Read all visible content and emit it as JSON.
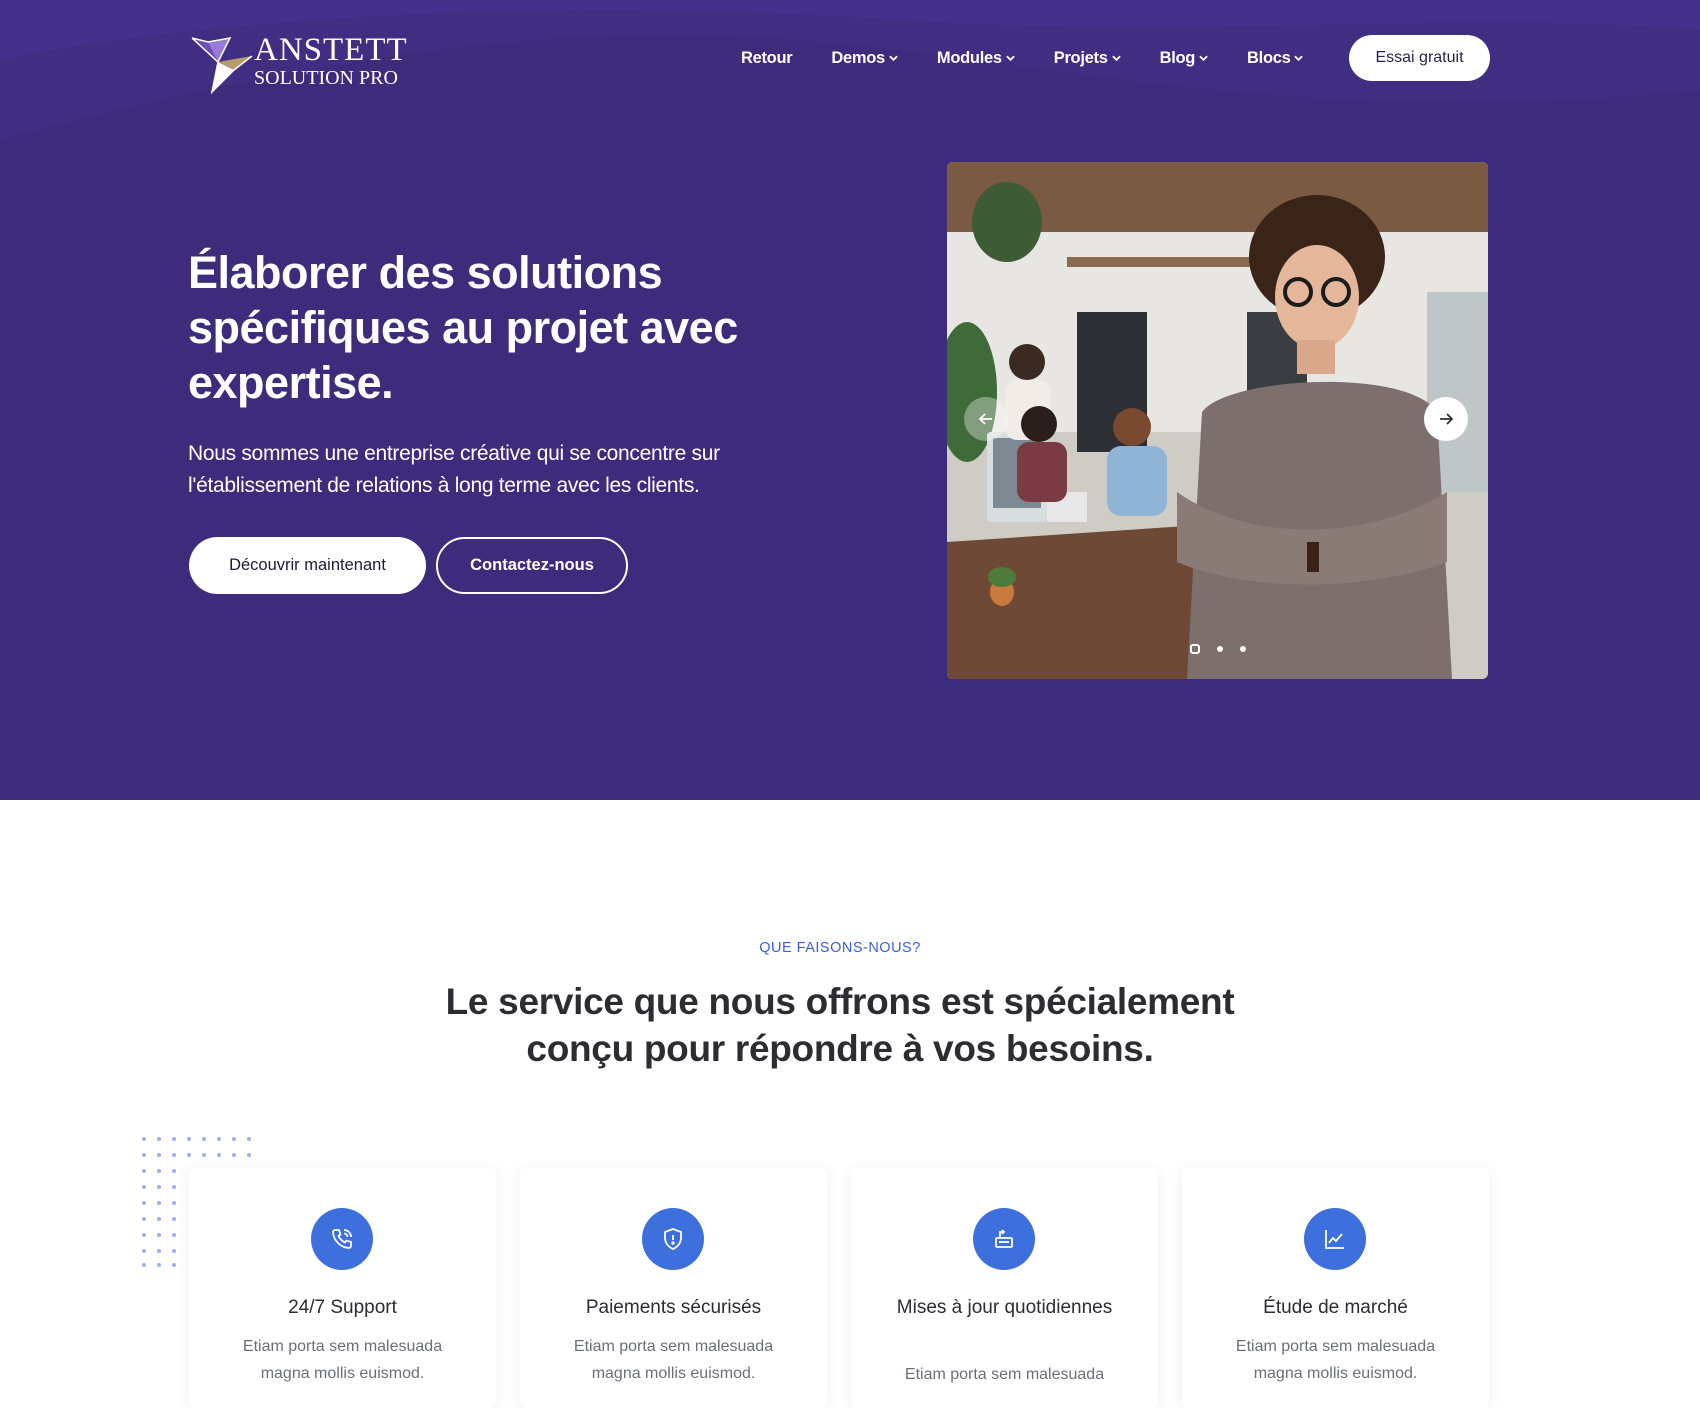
{
  "brand": {
    "name_line1": "ANSTETT",
    "name_line2": "SOLUTION PRO"
  },
  "nav": {
    "items": [
      {
        "label": "Retour"
      },
      {
        "label": "Demos"
      },
      {
        "label": "Modules"
      },
      {
        "label": "Projets"
      },
      {
        "label": "Blog"
      },
      {
        "label": "Blocs"
      }
    ],
    "cta_label": "Essai gratuit"
  },
  "hero": {
    "title": "Élaborer des solutions spécifiques au projet avec expertise.",
    "subtitle": "Nous sommes une entreprise créative qui se concentre sur l'établissement de relations à long terme avec les clients.",
    "primary_button": "Découvrir maintenant",
    "secondary_button": "Contactez-nous",
    "slider": {
      "slide_count": 3,
      "active_slide": 1
    }
  },
  "services": {
    "kicker": "QUE FAISONS-NOUS?",
    "title": "Le service que nous offrons est spécialement conçu pour répondre à vos besoins.",
    "cards": [
      {
        "icon": "phone-icon",
        "title": "24/7 Support",
        "text": "Etiam porta sem malesuada magna mollis euismod."
      },
      {
        "icon": "shield-icon",
        "title": "Paiements sécurisés",
        "text": "Etiam porta sem malesuada magna mollis euismod."
      },
      {
        "icon": "update-icon",
        "title": "Mises à jour quotidiennes",
        "text": "Etiam porta sem malesuada"
      },
      {
        "icon": "chart-line-icon",
        "title": "Étude de marché",
        "text": "Etiam porta sem malesuada magna mollis euismod."
      }
    ]
  },
  "colors": {
    "hero_bg": "#3d2b7b",
    "accent_blue": "#3d6fdd",
    "kicker_blue": "#3b5fd6",
    "heading_dark": "#2b2d33"
  }
}
